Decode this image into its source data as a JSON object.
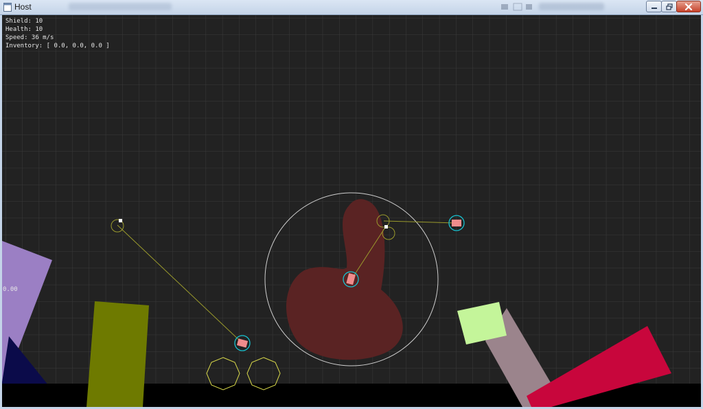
{
  "window": {
    "title": "Host",
    "app_icon": "window-icon",
    "controls": {
      "minimize_icon": "minimize-icon",
      "maximize_icon": "maximize-icon",
      "close_icon": "close-icon"
    }
  },
  "hud": {
    "shield": "Shield: 10",
    "health": "Health: 10",
    "speed": "Speed: 36 m/s",
    "inventory": "Inventory: [ 0.0, 0.0, 0.0 ]"
  },
  "axis_label": "0.00",
  "colors": {
    "background": "#222222",
    "grid": "#3a3a3a",
    "ground": "#000000",
    "purple_block": "#9b7fc4",
    "navy_block": "#0b0b4a",
    "olive_block": "#6e7a00",
    "mauve_block": "#9b848c",
    "lime_block": "#c4f59a",
    "crimson_block": "#c8063c",
    "blob": "#5a2323",
    "player_ring": "#17c3d1",
    "player_body": "#f08c8c",
    "tether": "#9a9a2c",
    "range_circle": "#cfcfcf",
    "wheel": "#d8d84a"
  }
}
